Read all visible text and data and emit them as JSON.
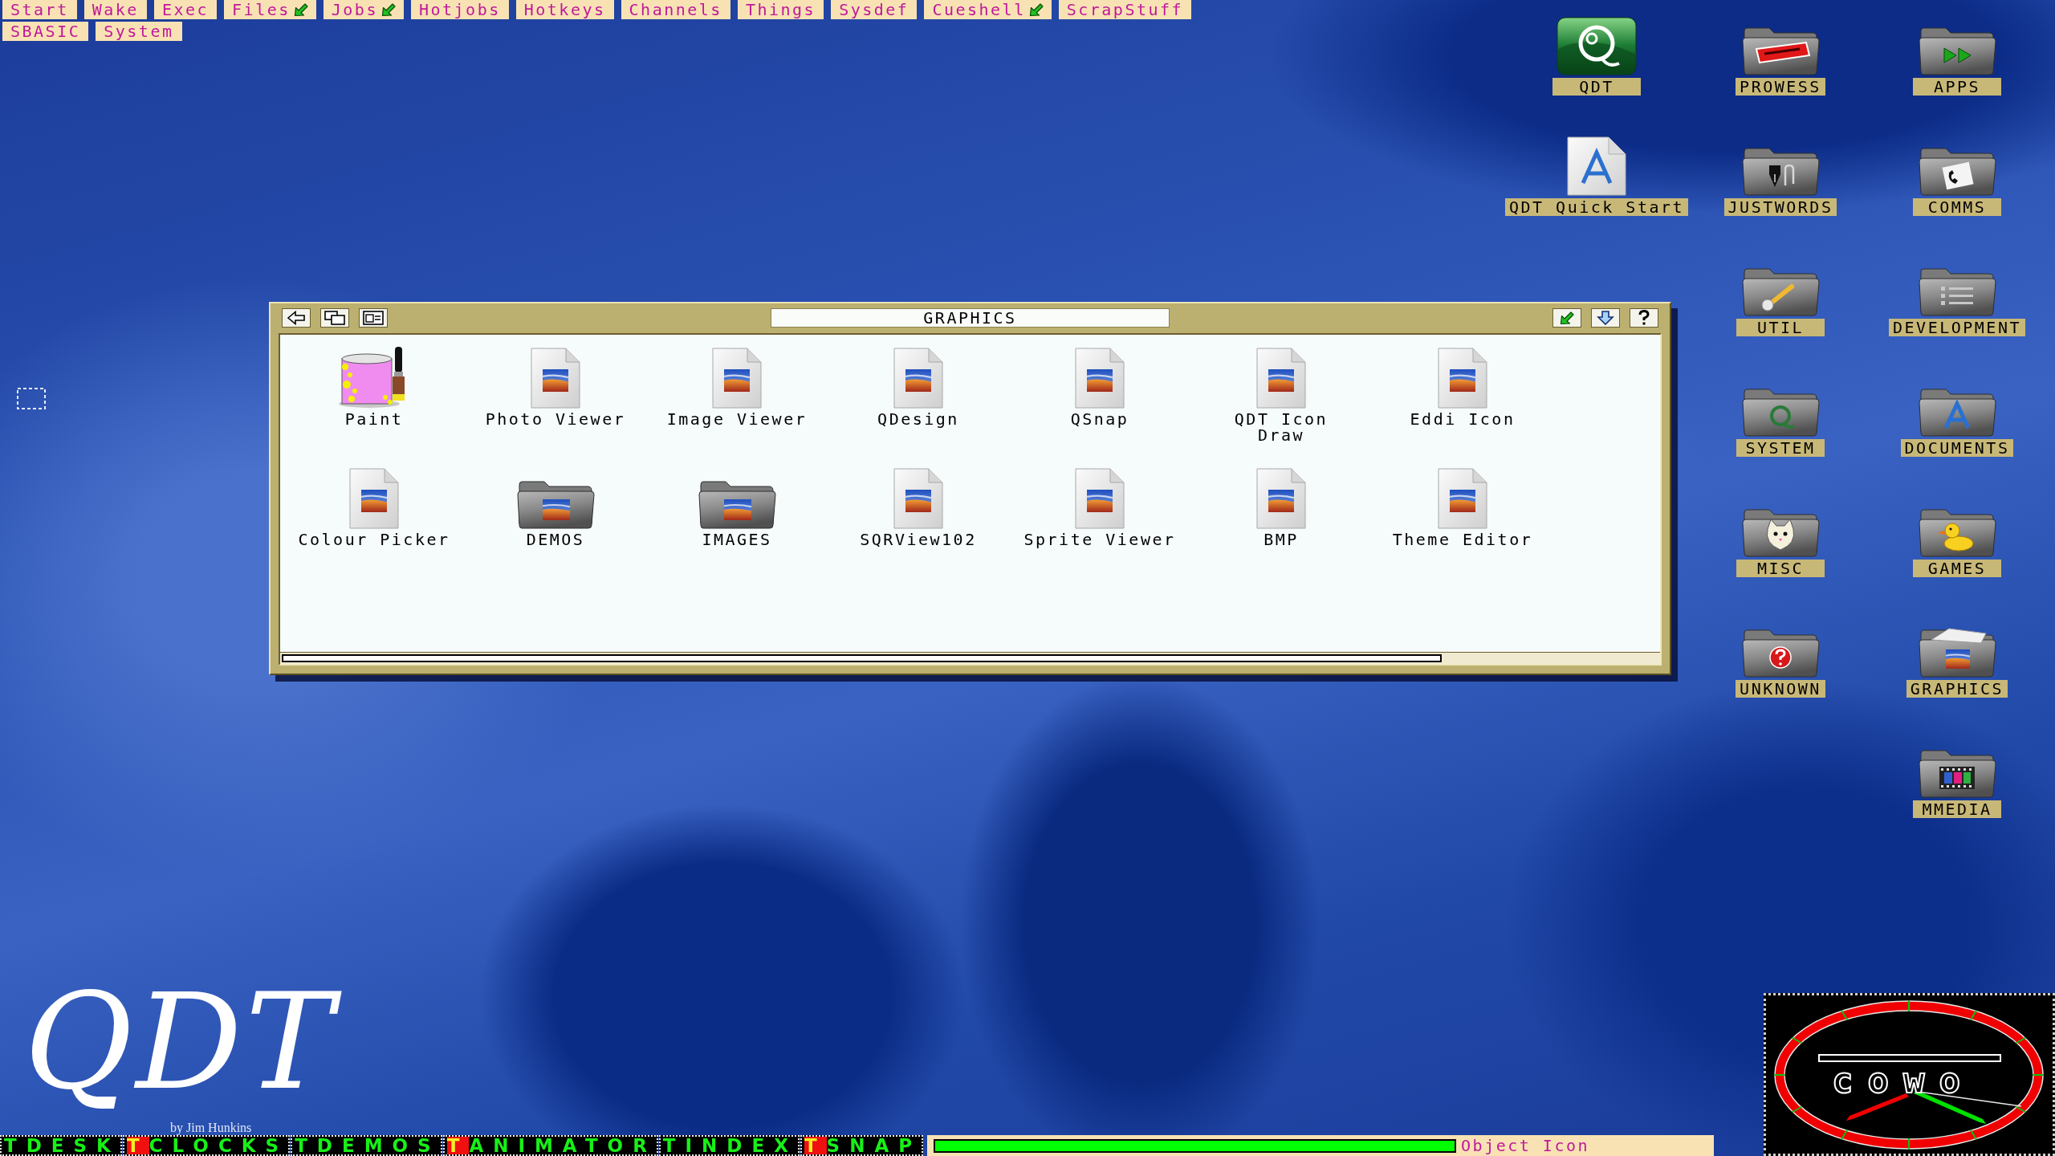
{
  "menu_bar": {
    "rows": [
      [
        {
          "label": "Start",
          "submenu": false
        },
        {
          "label": "Wake",
          "submenu": false
        },
        {
          "label": "Exec",
          "submenu": false
        },
        {
          "label": "Files",
          "submenu": true
        },
        {
          "label": "Jobs",
          "submenu": true
        },
        {
          "label": "Hotjobs",
          "submenu": false
        },
        {
          "label": "Hotkeys",
          "submenu": false
        },
        {
          "label": "Channels",
          "submenu": false
        },
        {
          "label": "Things",
          "submenu": false
        },
        {
          "label": "Sysdef",
          "submenu": false
        },
        {
          "label": "Cueshell",
          "submenu": true
        },
        {
          "label": "ScrapStuff",
          "submenu": false
        }
      ],
      [
        {
          "label": "SBASIC",
          "submenu": false
        },
        {
          "label": "System",
          "submenu": false
        }
      ]
    ]
  },
  "desktop": {
    "icon_columns": [
      [
        {
          "label": "QDT",
          "kind": "app"
        },
        {
          "label": "QDT Quick Start",
          "kind": "document"
        }
      ],
      [
        {
          "label": "PROWESS",
          "kind": "folder"
        },
        {
          "label": "JUSTWORDS",
          "kind": "folder"
        },
        {
          "label": "UTIL",
          "kind": "folder"
        },
        {
          "label": "SYSTEM",
          "kind": "folder"
        },
        {
          "label": "MISC",
          "kind": "folder"
        },
        {
          "label": "UNKNOWN",
          "kind": "folder"
        }
      ],
      [
        {
          "label": "APPS",
          "kind": "folder"
        },
        {
          "label": "COMMS",
          "kind": "folder"
        },
        {
          "label": "DEVELOPMENT",
          "kind": "folder"
        },
        {
          "label": "DOCUMENTS",
          "kind": "folder"
        },
        {
          "label": "GAMES",
          "kind": "folder"
        },
        {
          "label": "GRAPHICS",
          "kind": "folder"
        },
        {
          "label": "MMEDIA",
          "kind": "folder"
        }
      ]
    ]
  },
  "window": {
    "title": "GRAPHICS",
    "items": [
      {
        "label": "Paint",
        "kind": "app"
      },
      {
        "label": "Photo Viewer",
        "kind": "file"
      },
      {
        "label": "Image Viewer",
        "kind": "file"
      },
      {
        "label": "QDesign",
        "kind": "file"
      },
      {
        "label": "QSnap",
        "kind": "file"
      },
      {
        "label": "QDT Icon\nDraw",
        "kind": "file"
      },
      {
        "label": "Eddi Icon",
        "kind": "file"
      },
      {
        "label": "Colour Picker",
        "kind": "file"
      },
      {
        "label": "DEMOS",
        "kind": "folder"
      },
      {
        "label": "IMAGES",
        "kind": "folder"
      },
      {
        "label": "SQRView102",
        "kind": "file"
      },
      {
        "label": "Sprite Viewer",
        "kind": "file"
      },
      {
        "label": "BMP",
        "kind": "file"
      },
      {
        "label": "Theme Editor",
        "kind": "file"
      }
    ]
  },
  "logo": {
    "title": "QDT",
    "byline": "by Jim Hunkins"
  },
  "taskbar": {
    "jobs": [
      {
        "prefix": "T",
        "name": "DESK",
        "highlighted": false
      },
      {
        "prefix": "T",
        "name": "CLOCKS",
        "highlighted": true
      },
      {
        "prefix": "T",
        "name": "DEMOS",
        "highlighted": false
      },
      {
        "prefix": "T",
        "name": "ANIMATOR",
        "highlighted": true
      },
      {
        "prefix": "T",
        "name": "INDEX",
        "highlighted": false
      },
      {
        "prefix": "T",
        "name": "SNAP",
        "highlighted": true
      }
    ]
  },
  "status": {
    "level": 1,
    "text": "Object Icon"
  },
  "clock": {
    "logo": "cowo"
  }
}
